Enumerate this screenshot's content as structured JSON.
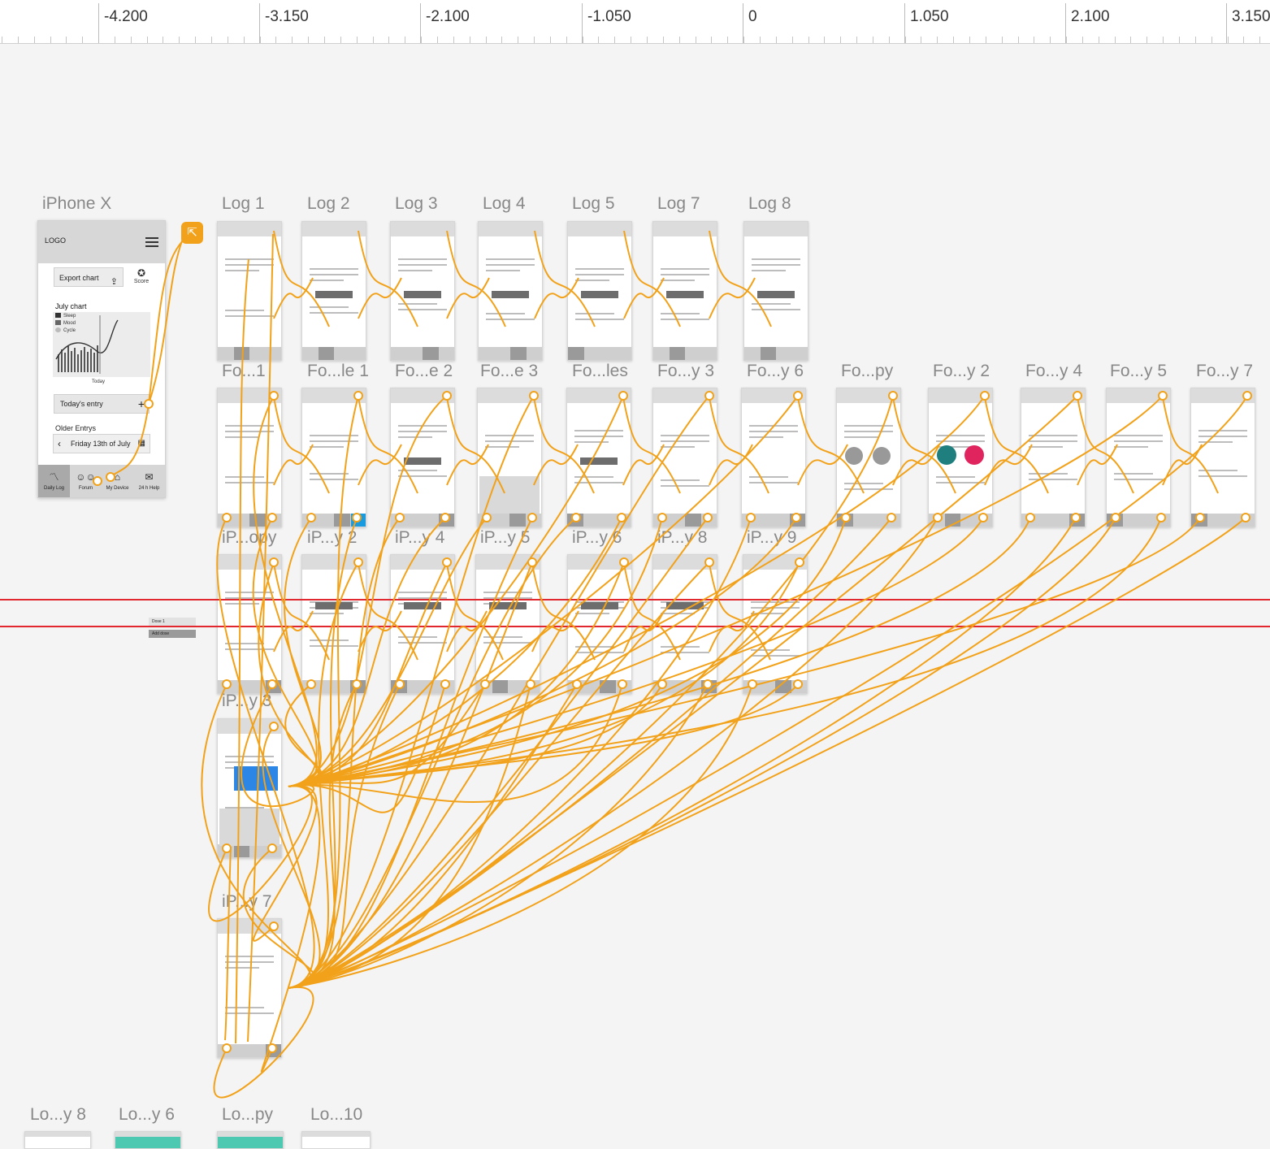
{
  "ruler": {
    "labels": [
      "-4.200",
      "-3.150",
      "-2.100",
      "-1.050",
      "0",
      "1.050",
      "2.100",
      "3.150"
    ]
  },
  "artboards": [
    {
      "id": "iphonex",
      "label": "iPhone X"
    },
    {
      "id": "log1",
      "label": "Log 1"
    },
    {
      "id": "log2",
      "label": "Log 2"
    },
    {
      "id": "log3",
      "label": "Log 3"
    },
    {
      "id": "log4",
      "label": "Log 4"
    },
    {
      "id": "log5",
      "label": "Log 5"
    },
    {
      "id": "log7",
      "label": "Log 7"
    },
    {
      "id": "log8",
      "label": "Log 8"
    },
    {
      "id": "fo1",
      "label": "Fo...1"
    },
    {
      "id": "fo2",
      "label": "Fo...le 1"
    },
    {
      "id": "fo3",
      "label": "Fo...e 2"
    },
    {
      "id": "fo4",
      "label": "Fo...e 3"
    },
    {
      "id": "fo5",
      "label": "Fo...les"
    },
    {
      "id": "fo6",
      "label": "Fo...y 3"
    },
    {
      "id": "fo7",
      "label": "Fo...y 6"
    },
    {
      "id": "fo8",
      "label": "Fo...py"
    },
    {
      "id": "fo9",
      "label": "Fo...y 2"
    },
    {
      "id": "fo10",
      "label": "Fo...y 4"
    },
    {
      "id": "fo11",
      "label": "Fo...y 5"
    },
    {
      "id": "fo12",
      "label": "Fo...y 7"
    },
    {
      "id": "ip1",
      "label": "iP...opy"
    },
    {
      "id": "ip2",
      "label": "iP...y 2"
    },
    {
      "id": "ip3",
      "label": "iP...y 4"
    },
    {
      "id": "ip4",
      "label": "iP...y 5"
    },
    {
      "id": "ip5",
      "label": "iP...y 6"
    },
    {
      "id": "ip6",
      "label": "iP...y 8"
    },
    {
      "id": "ip7",
      "label": "iP...y 9"
    },
    {
      "id": "ip8",
      "label": "iP...y 3"
    },
    {
      "id": "ip9",
      "label": "iP...y 7"
    },
    {
      "id": "lo1",
      "label": "Lo...y 8"
    },
    {
      "id": "lo2",
      "label": "Lo...y 6"
    },
    {
      "id": "lo3",
      "label": "Lo...py"
    },
    {
      "id": "lo4",
      "label": "Lo...10"
    }
  ],
  "iphonex": {
    "logo": "LOGO",
    "export_chart": "Export chart",
    "score": "Score",
    "chart_title": "July chart",
    "legend": [
      "Sleep",
      "Mood",
      "Cycle"
    ],
    "today_axis": "Today",
    "todays_entry": "Today's entry",
    "older_entries": "Older Entrys",
    "date": "Friday 13th of July",
    "tabs": [
      "Daily Log",
      "Forum",
      "My Device",
      "24 h Help"
    ]
  },
  "mini_dose": {
    "dose": "Dose 1",
    "add": "Add dose"
  },
  "colors": {
    "wire": "#f2a21a",
    "guide": "#e0282e",
    "canvas": "#f4f4f4"
  }
}
